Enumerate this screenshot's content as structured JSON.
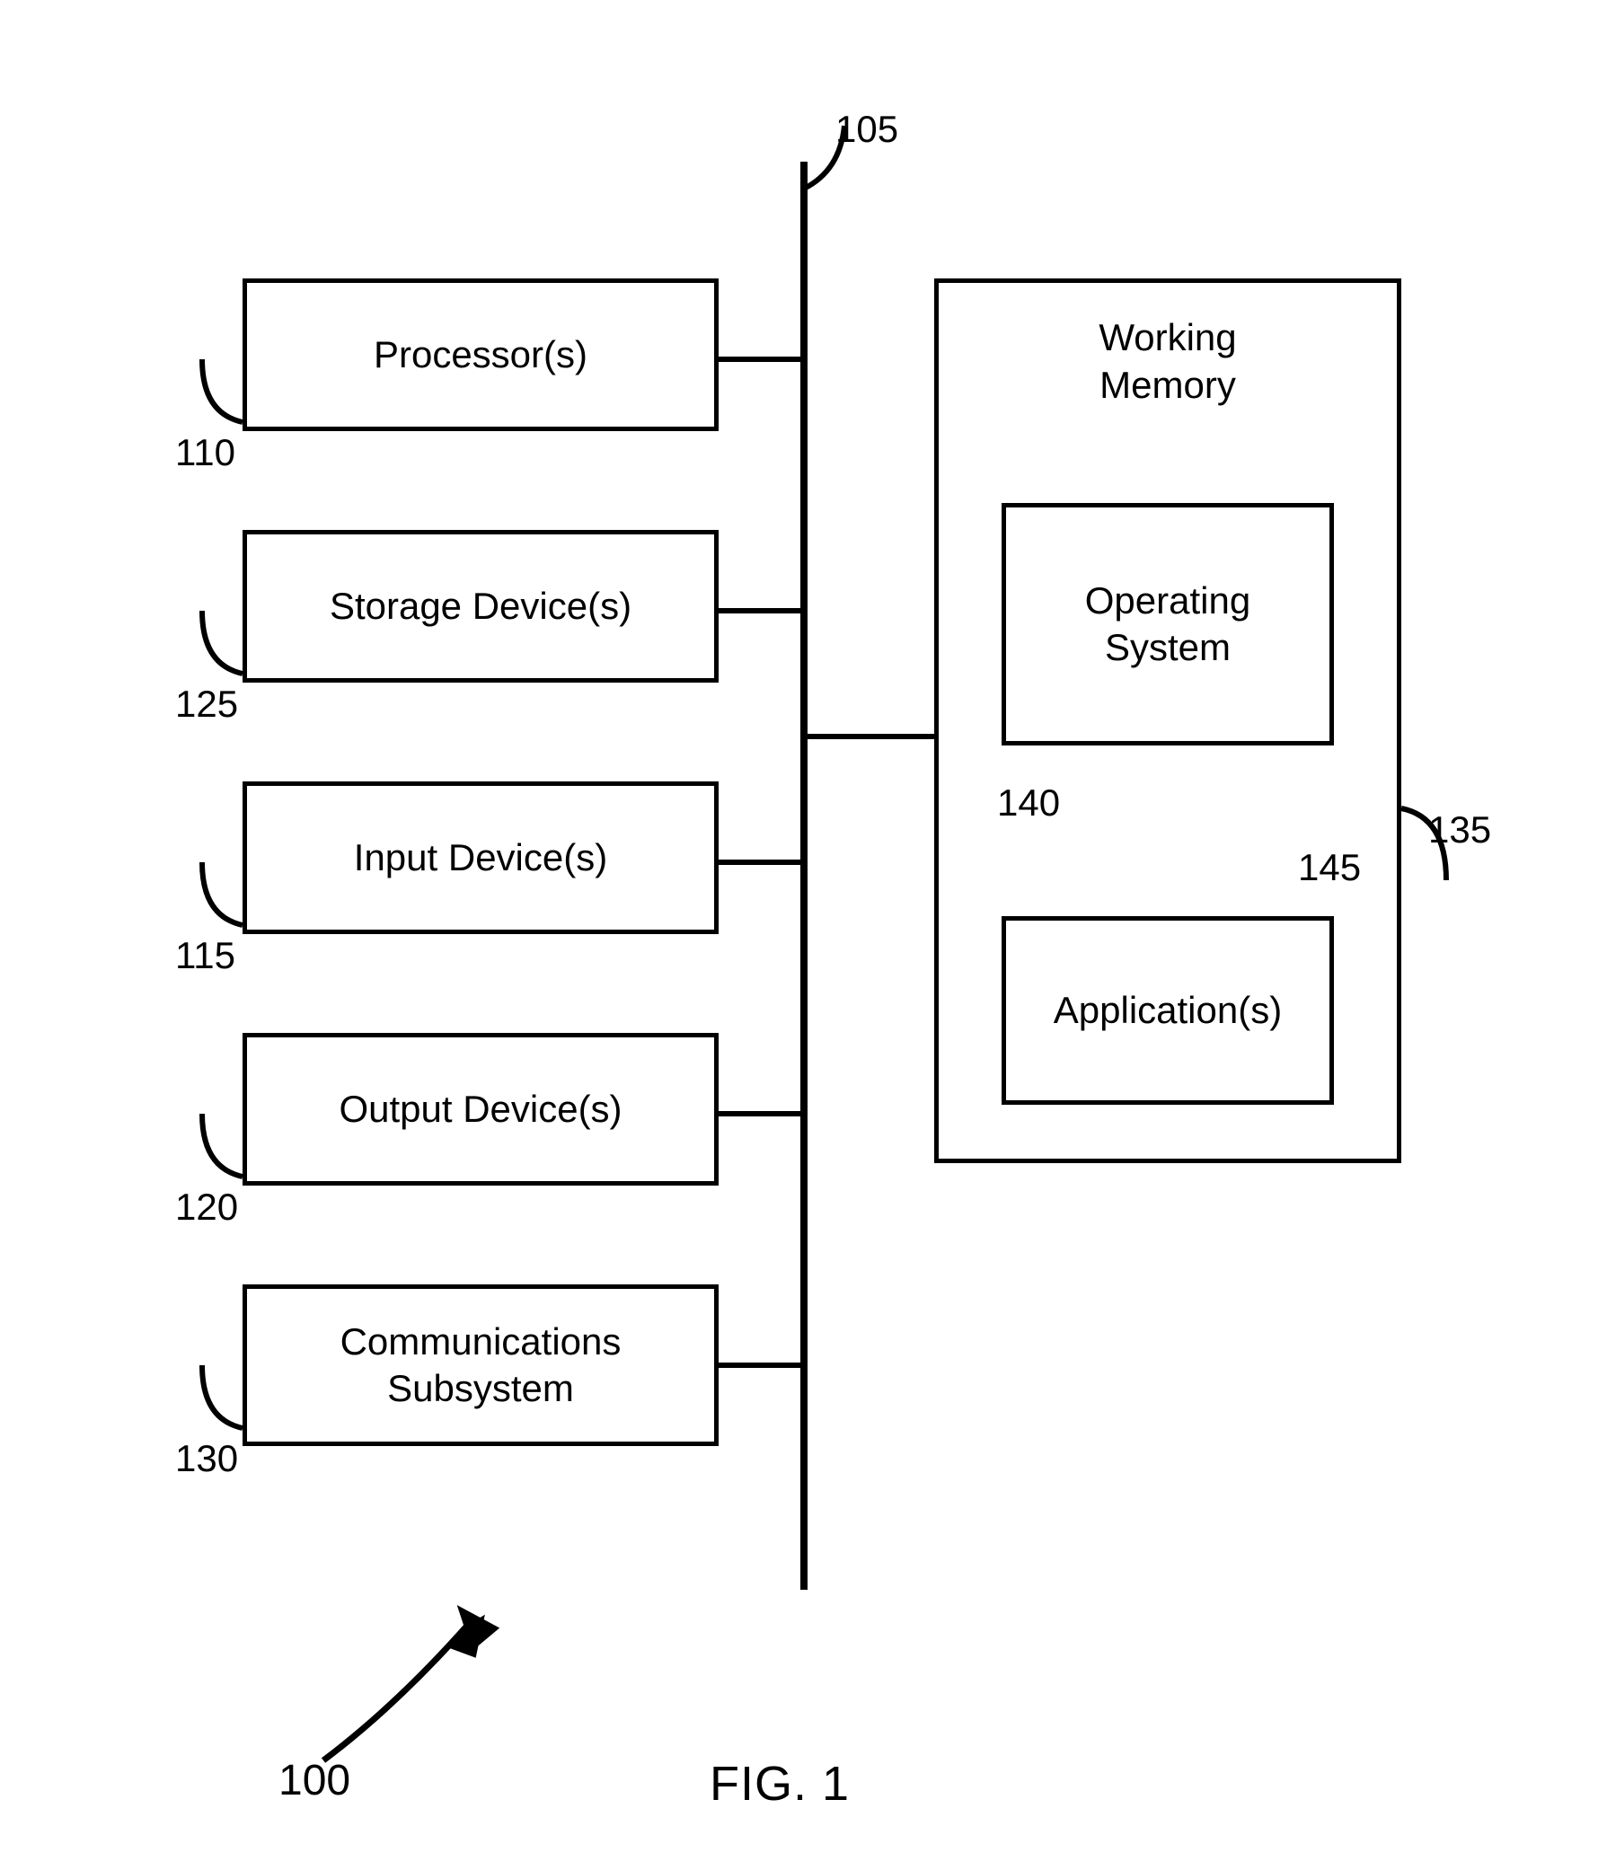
{
  "figure_label": "FIG. 1",
  "system_ref": "100",
  "bus": {
    "ref": "105"
  },
  "left_blocks": [
    {
      "label": "Processor(s)",
      "ref": "110"
    },
    {
      "label": "Storage Device(s)",
      "ref": "125"
    },
    {
      "label": "Input Device(s)",
      "ref": "115"
    },
    {
      "label": "Output Device(s)",
      "ref": "120"
    },
    {
      "label": "Communications\nSubsystem",
      "ref": "130"
    }
  ],
  "working_memory": {
    "label": "Working\nMemory",
    "ref": "135",
    "os": {
      "label": "Operating\nSystem",
      "ref": "140"
    },
    "apps": {
      "label": "Application(s)",
      "ref": "145"
    }
  }
}
